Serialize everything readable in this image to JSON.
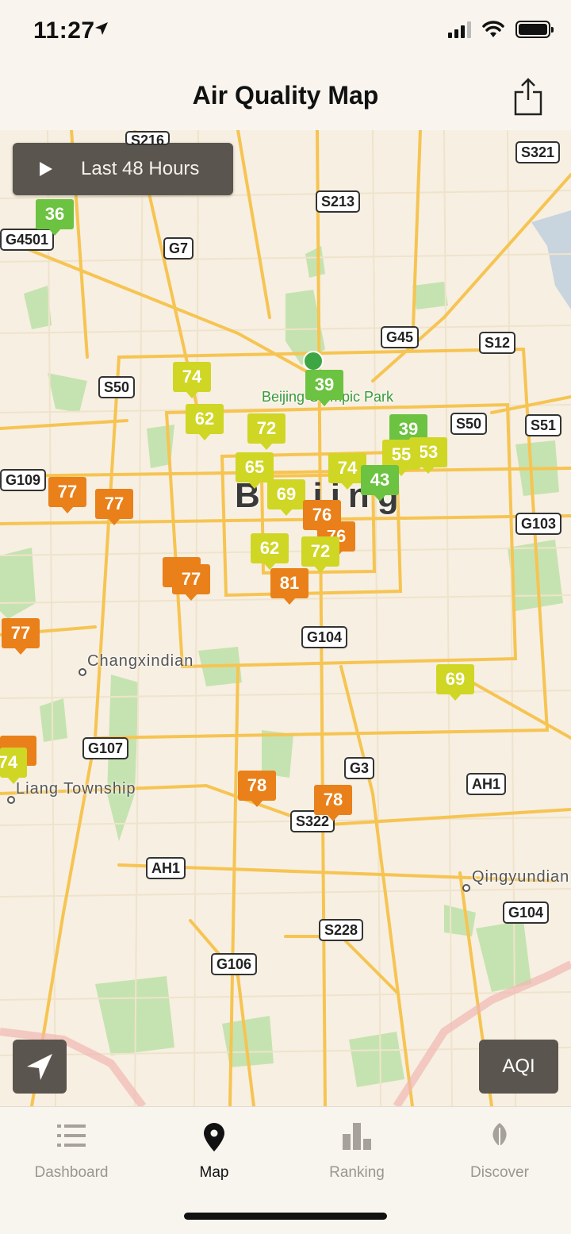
{
  "status_bar": {
    "time": "11:27"
  },
  "header": {
    "title": "Air Quality Map",
    "share_icon": "share-icon"
  },
  "map": {
    "playback_label": "Last 48 Hours",
    "city_label": "Beijing",
    "park_label": "Beijing Olympic Park",
    "places": {
      "changxindian": "Changxindian",
      "liang": "Liang Township",
      "qingyundian": "Qingyundian"
    },
    "shields": {
      "s216": "S216",
      "s321": "S321",
      "s213": "S213",
      "g4501": "G4501",
      "g7": "G7",
      "g45": "G45",
      "s12": "S12",
      "s50a": "S50",
      "s50b": "S50",
      "s51": "S51",
      "g109": "G109",
      "g103": "G103",
      "g104a": "G104",
      "g107": "G107",
      "g3": "G3",
      "ah1a": "AH1",
      "s322": "S322",
      "ah1b": "AH1",
      "g104b": "G104",
      "s228": "S228",
      "g106": "G106"
    },
    "markers": {
      "m36": "36",
      "m74a": "74",
      "m39a": "39",
      "m62a": "62",
      "m72a": "72",
      "m39b": "39",
      "m55": "55",
      "m53": "53",
      "m65": "65",
      "m74b": "74",
      "m43": "43",
      "m77a": "77",
      "m77b": "77",
      "m69a": "69",
      "m76a": "76",
      "m76b": "76",
      "m62b": "62",
      "m72b": "72",
      "m77c": "77",
      "m81": "81",
      "m77d": "77",
      "m69b": "69",
      "m74c": "74",
      "m78a": "78",
      "m78b": "78"
    },
    "aqi_button": "AQI",
    "colors": {
      "good": "#6cc241",
      "moderate": "#cfd624",
      "unhealthy_sensitive": "#e9801a"
    }
  },
  "tabs": [
    {
      "label": "Dashboard",
      "icon": "list-icon"
    },
    {
      "label": "Map",
      "icon": "map-pin-icon",
      "active": true
    },
    {
      "label": "Ranking",
      "icon": "bar-chart-icon"
    },
    {
      "label": "Discover",
      "icon": "leaf-icon"
    }
  ]
}
